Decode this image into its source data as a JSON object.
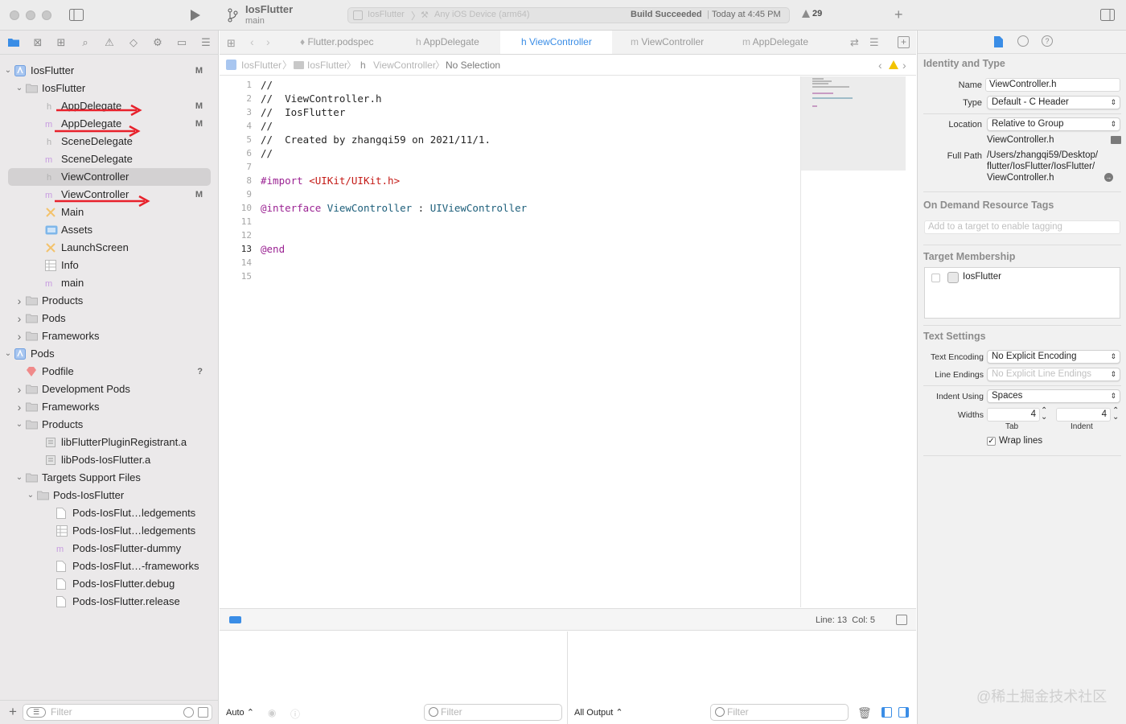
{
  "titlebar": {
    "project_name": "IosFlutter",
    "branch": "main",
    "scheme": "IosFlutter",
    "destination": "Any iOS Device (arm64)",
    "build_status": "Build Succeeded",
    "build_time": "Today at 4:45 PM",
    "warnings_count": "29"
  },
  "navigator": {
    "items": [
      {
        "label": "IosFlutter",
        "badge": "M"
      },
      {
        "label": "IosFlutter",
        "badge": ""
      },
      {
        "label": "AppDelegate",
        "badge": "M"
      },
      {
        "label": "AppDelegate",
        "badge": "M"
      },
      {
        "label": "SceneDelegate",
        "badge": ""
      },
      {
        "label": "SceneDelegate",
        "badge": ""
      },
      {
        "label": "ViewController",
        "badge": ""
      },
      {
        "label": "ViewController",
        "badge": "M"
      },
      {
        "label": "Main",
        "badge": ""
      },
      {
        "label": "Assets",
        "badge": ""
      },
      {
        "label": "LaunchScreen",
        "badge": ""
      },
      {
        "label": "Info",
        "badge": ""
      },
      {
        "label": "main",
        "badge": ""
      },
      {
        "label": "Products",
        "badge": ""
      },
      {
        "label": "Pods",
        "badge": ""
      },
      {
        "label": "Frameworks",
        "badge": ""
      },
      {
        "label": "Pods",
        "badge": ""
      },
      {
        "label": "Podfile",
        "badge": "?"
      },
      {
        "label": "Development Pods",
        "badge": ""
      },
      {
        "label": "Frameworks",
        "badge": ""
      },
      {
        "label": "Products",
        "badge": ""
      },
      {
        "label": "libFlutterPluginRegistrant.a",
        "badge": ""
      },
      {
        "label": "libPods-IosFlutter.a",
        "badge": ""
      },
      {
        "label": "Targets Support Files",
        "badge": ""
      },
      {
        "label": "Pods-IosFlutter",
        "badge": ""
      },
      {
        "label": "Pods-IosFlut…ledgements",
        "badge": ""
      },
      {
        "label": "Pods-IosFlut…ledgements",
        "badge": ""
      },
      {
        "label": "Pods-IosFlutter-dummy",
        "badge": ""
      },
      {
        "label": "Pods-IosFlut…-frameworks",
        "badge": ""
      },
      {
        "label": "Pods-IosFlutter.debug",
        "badge": ""
      },
      {
        "label": "Pods-IosFlutter.release",
        "badge": ""
      }
    ],
    "filter_placeholder": "Filter"
  },
  "editor": {
    "tabs": [
      {
        "label": "Flutter.podspec"
      },
      {
        "label": "AppDelegate"
      },
      {
        "label": "ViewController"
      },
      {
        "label": "ViewController"
      },
      {
        "label": "AppDelegate"
      }
    ],
    "jumpbar": {
      "project": "IosFlutter",
      "group": "IosFlutter",
      "file": "ViewController",
      "selection": "No Selection"
    },
    "lines": [
      {
        "n": "1",
        "text": "//"
      },
      {
        "n": "2",
        "text": "//  ViewController.h"
      },
      {
        "n": "3",
        "text": "//  IosFlutter"
      },
      {
        "n": "4",
        "text": "//"
      },
      {
        "n": "5",
        "text": "//  Created by zhangqi59 on 2021/11/1."
      },
      {
        "n": "6",
        "text": "//"
      },
      {
        "n": "7",
        "text": ""
      },
      {
        "n": "8",
        "text": "",
        "kw": "#import",
        "str": "<UIKit/UIKit.h>"
      },
      {
        "n": "9",
        "text": ""
      },
      {
        "n": "10",
        "text": "",
        "kw": "@interface",
        "cls": "ViewController",
        "sep": " : ",
        "sup": "UIViewController"
      },
      {
        "n": "11",
        "text": ""
      },
      {
        "n": "12",
        "text": ""
      },
      {
        "n": "13",
        "text": "",
        "kw": "@end"
      },
      {
        "n": "14",
        "text": ""
      },
      {
        "n": "15",
        "text": ""
      }
    ],
    "status": "Line: 13  Col: 5"
  },
  "debug": {
    "left_mode": "Auto",
    "left_filter_placeholder": "Filter",
    "right_mode": "All Output",
    "right_filter_placeholder": "Filter"
  },
  "inspector": {
    "identity_title": "Identity and Type",
    "name_label": "Name",
    "name_value": "ViewController.h",
    "type_label": "Type",
    "type_value": "Default - C Header",
    "location_label": "Location",
    "location_value": "Relative to Group",
    "location_file": "ViewController.h",
    "fullpath_label": "Full Path",
    "fullpath_value_1": "/Users/zhangqi59/Desktop/",
    "fullpath_value_2": "flutter/IosFlutter/IosFlutter/",
    "fullpath_value_3": "ViewController.h",
    "odr_title": "On Demand Resource Tags",
    "odr_placeholder": "Add to a target to enable tagging",
    "target_title": "Target Membership",
    "target_name": "IosFlutter",
    "text_title": "Text Settings",
    "encoding_label": "Text Encoding",
    "encoding_value": "No Explicit Encoding",
    "endings_label": "Line Endings",
    "endings_value": "No Explicit Line Endings",
    "indent_label": "Indent Using",
    "indent_value": "Spaces",
    "widths_label": "Widths",
    "tab_width": "4",
    "indent_width": "4",
    "tab_caption": "Tab",
    "indent_caption": "Indent",
    "wrap_label": "Wrap lines"
  },
  "watermark": "@稀土掘金技术社区",
  "colors": {
    "accent": "#3a8de6",
    "annotation_arrow": "#e8212b",
    "keyword": "#9b2393",
    "string": "#c41a16",
    "type": "#1c5e7a"
  }
}
